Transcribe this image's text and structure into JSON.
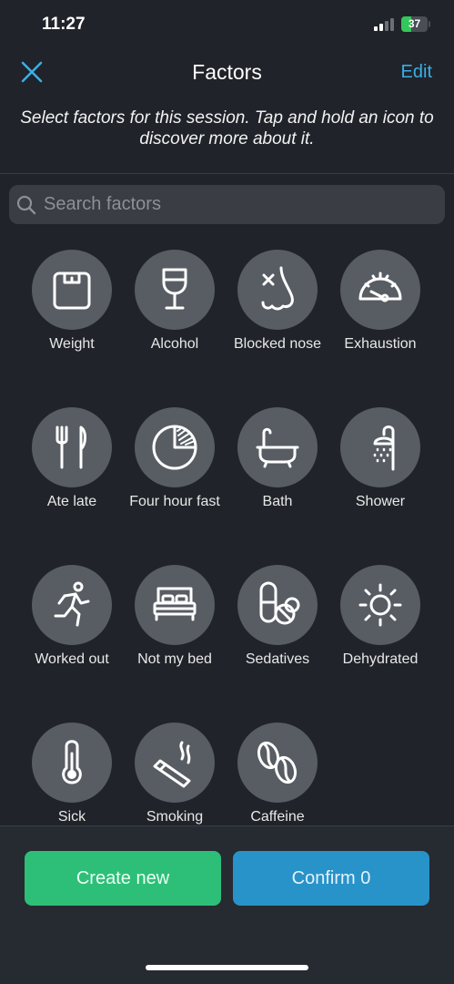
{
  "status_bar": {
    "time": "11:27",
    "battery_level": "37",
    "battery_color": "#34c759"
  },
  "header": {
    "title": "Factors",
    "edit_label": "Edit",
    "instructions": "Select factors for this session. Tap and hold an icon to discover more about it.",
    "accent_color": "#3aaee8"
  },
  "search": {
    "placeholder": "Search factors",
    "value": ""
  },
  "factors": [
    {
      "label": "Weight",
      "icon": "scale-icon"
    },
    {
      "label": "Alcohol",
      "icon": "wine-glass-icon"
    },
    {
      "label": "Blocked nose",
      "icon": "nose-icon"
    },
    {
      "label": "Exhaustion",
      "icon": "gauge-icon"
    },
    {
      "label": "Ate late",
      "icon": "fork-knife-icon"
    },
    {
      "label": "Four hour fast",
      "icon": "clock-pie-icon"
    },
    {
      "label": "Bath",
      "icon": "bathtub-icon"
    },
    {
      "label": "Shower",
      "icon": "shower-icon"
    },
    {
      "label": "Worked out",
      "icon": "running-person-icon"
    },
    {
      "label": "Not my bed",
      "icon": "bed-icon"
    },
    {
      "label": "Sedatives",
      "icon": "pills-icon"
    },
    {
      "label": "Dehydrated",
      "icon": "sun-icon"
    },
    {
      "label": "Sick",
      "icon": "thermometer-icon"
    },
    {
      "label": "Smoking",
      "icon": "cigarette-icon"
    },
    {
      "label": "Caffeine",
      "icon": "coffee-beans-icon"
    }
  ],
  "footer": {
    "create_label": "Create new",
    "confirm_label": "Confirm 0"
  }
}
